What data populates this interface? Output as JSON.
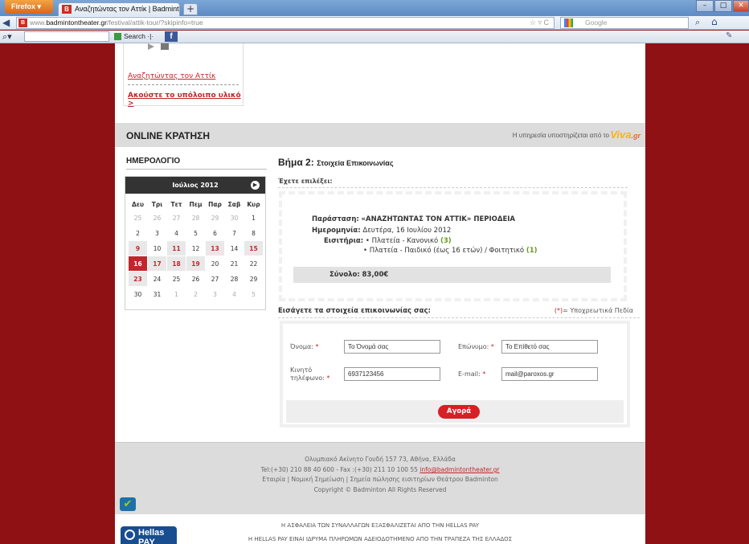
{
  "browser": {
    "app_button": "Firefox",
    "tab_title": "Αναζητώντας τον Αττίκ | Badminton Th...",
    "url_prefix": "www.",
    "url_domain": "badmintontheater.gr",
    "url_path": "/festival/attik-tour/?skipinfo=true",
    "search_engine": "Google",
    "toolbar_search_label": "Search"
  },
  "audio": {
    "track_link": "Αναζητώντας τον Αττίκ",
    "more_link": "Ακούστε το υπόλοιπο υλικό >"
  },
  "booking": {
    "title": "ONLINE ΚΡΑΤΗΣΗ",
    "powered_by": "Η υπηρεσία υποστηρίζεται από το",
    "viva_logo": "Viva",
    "viva_suffix": ".gr"
  },
  "calendar": {
    "title": "ΗΜΕΡΟΛΟΓΙΟ",
    "month": "Ιούλιος 2012",
    "weekdays": [
      "Δευ",
      "Τρι",
      "Τετ",
      "Πεμ",
      "Παρ",
      "Σαβ",
      "Κυρ"
    ],
    "weeks": [
      [
        "25",
        "26",
        "27",
        "28",
        "29",
        "30",
        "1"
      ],
      [
        "2",
        "3",
        "4",
        "5",
        "6",
        "7",
        "8"
      ],
      [
        "9",
        "10",
        "11",
        "12",
        "13",
        "14",
        "15"
      ],
      [
        "16",
        "17",
        "18",
        "19",
        "20",
        "21",
        "22"
      ],
      [
        "23",
        "24",
        "25",
        "26",
        "27",
        "28",
        "29"
      ],
      [
        "30",
        "31",
        "1",
        "2",
        "3",
        "4",
        "5"
      ]
    ],
    "muted": [
      "0-0",
      "0-1",
      "0-2",
      "0-3",
      "0-4",
      "0-5",
      "5-2",
      "5-3",
      "5-4",
      "5-5",
      "5-6"
    ],
    "highlighted": [
      "2-0",
      "2-2",
      "2-4",
      "2-6",
      "3-1",
      "3-2",
      "3-3",
      "4-0"
    ],
    "selected": "3-0"
  },
  "step": {
    "title": "Βήμα 2:",
    "subtitle": "Στοιχεία Επικοινωνίας",
    "chosen_label": "Έχετε επιλέξει:",
    "show_label": "Παράσταση:",
    "show_value": "«ΑΝΑΖΗΤΩΝΤΑΣ ΤΟΝ ΑΤΤΙΚ» ΠΕΡΙΟΔΕΙΑ",
    "date_label": "Ημερομηνία:",
    "date_value": "Δευτέρα, 16 Ιουλίου 2012",
    "tickets_label": "Εισιτήρια:",
    "ticket1_text": "• Πλατεία - Κανονικό",
    "ticket1_count": "(3)",
    "ticket2_text": "• Πλατεία - Παιδικό (έως 16 ετών) / Φοιτητικό",
    "ticket2_count": "(1)",
    "total_label": "Σύνολο:",
    "total_value": "83,00€"
  },
  "contact": {
    "label": "Εισάγετε τα στοιχεία επικοινωνίας σας:",
    "required_mark": "(*)",
    "required_note": "= Υποχρεωτικά Πεδία",
    "first_name_label": "Όνομα:",
    "first_name_value": "Το Όνομά σας",
    "last_name_label": "Επώνυμο:",
    "last_name_value": "Το Επίθετό σας",
    "mobile_label_1": "Κινητό",
    "mobile_label_2": "τηλέφωνο:",
    "mobile_value": "6937123456",
    "email_label": "E-mail:",
    "email_value": "mail@paroxos.gr",
    "asterisk": "*",
    "buy_button": "Αγορά"
  },
  "footer": {
    "address": "Ολυμπιακό Ακίνητο Γουδή 157 73, Αθήνα, Ελλάδα",
    "phones": "Tel:(+30) 210 88 40 600 - Fax :(+30) 211 10 100 55",
    "email": "info@badmintontheater.gr",
    "links": "Εταιρία | Νομική Σημείωση | Σημεία πώλησης εισιτηρίων Θεάτρου Badminton",
    "copyright": "Copyright © Badminton All Rights Reserved"
  },
  "hellas_pay": {
    "logo_text_1": "Hellas",
    "logo_text_2": "PAY",
    "line1": "Η ΑΣΦΑΛΕΙΑ ΤΩΝ ΣΥΝΑΛΛΑΓΩΝ ΕΞΑΣΦΑΛΙΖΕΤΑΙ ΑΠΟ ΤΗΝ HELLAS PAY",
    "line2": "H HELLAS PAY ΕΙΝΑΙ ΙΔΡΥΜΑ ΠΛΗΡΩΜΩΝ ΑΔΕΙΟΔΟΤΗΜΕΝΟ ΑΠΟ ΤΗΝ ΤΡΑΠΕΖΑ ΤΗΣ ΕΛΛΑΔΟΣ"
  },
  "colors": {
    "page_background": "#8f1114",
    "accent": "#c0272d",
    "button": "#d71f26"
  }
}
